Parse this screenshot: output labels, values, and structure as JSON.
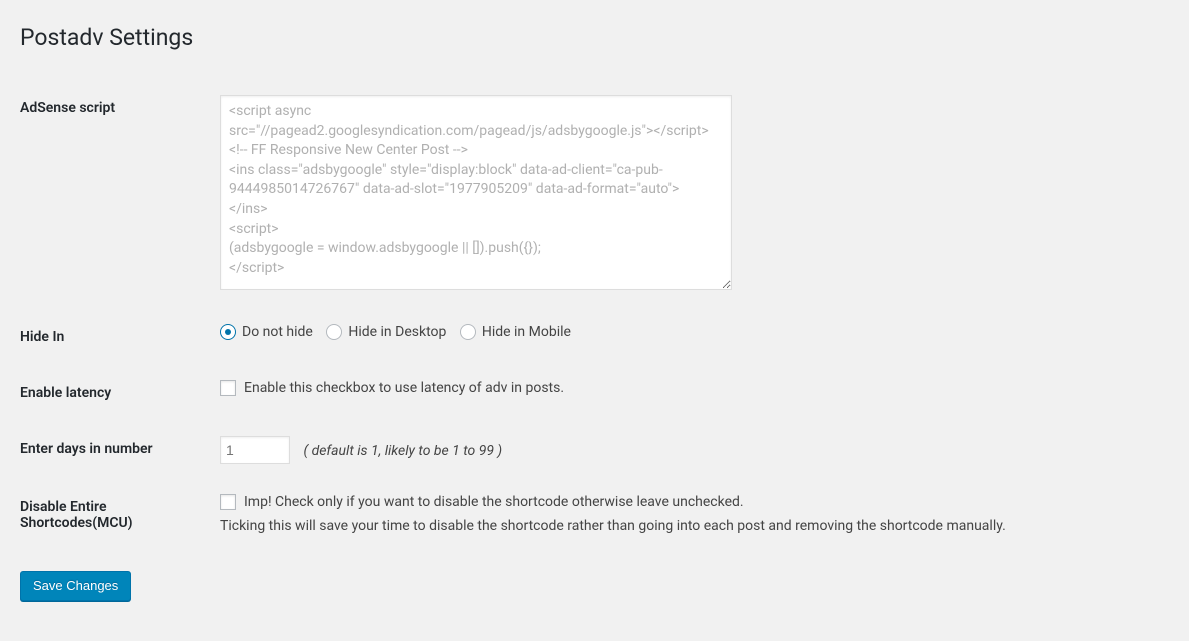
{
  "page": {
    "title": "Postadv Settings"
  },
  "fields": {
    "adsense": {
      "label": "AdSense script",
      "value": "<script async src=\"//pagead2.googlesyndication.com/pagead/js/adsbygoogle.js\"></script>\n<!-- FF Responsive New Center Post -->\n<ins class=\"adsbygoogle\" style=\"display:block\" data-ad-client=\"ca-pub-9444985014726767\" data-ad-slot=\"1977905209\" data-ad-format=\"auto\">\n</ins>\n<script>\n(adsbygoogle = window.adsbygoogle || []).push({});\n</script>"
    },
    "hide_in": {
      "label": "Hide In",
      "options": [
        {
          "label": "Do not hide",
          "checked": true
        },
        {
          "label": "Hide in Desktop",
          "checked": false
        },
        {
          "label": "Hide in Mobile",
          "checked": false
        }
      ]
    },
    "enable_latency": {
      "label": "Enable latency",
      "checkbox_label": "Enable this checkbox to use latency of adv in posts.",
      "checked": false
    },
    "days": {
      "label": "Enter days in number",
      "value": "1",
      "hint": "( default is 1, likely to be 1 to 99 )"
    },
    "disable_shortcodes": {
      "label": "Disable Entire Shortcodes(MCU)",
      "checkbox_label": "Imp! Check only if you want to disable the shortcode otherwise leave unchecked.",
      "description": "Ticking this will save your time to disable the shortcode rather than going into each post and removing the shortcode manually.",
      "checked": false
    }
  },
  "submit": {
    "label": "Save Changes"
  }
}
